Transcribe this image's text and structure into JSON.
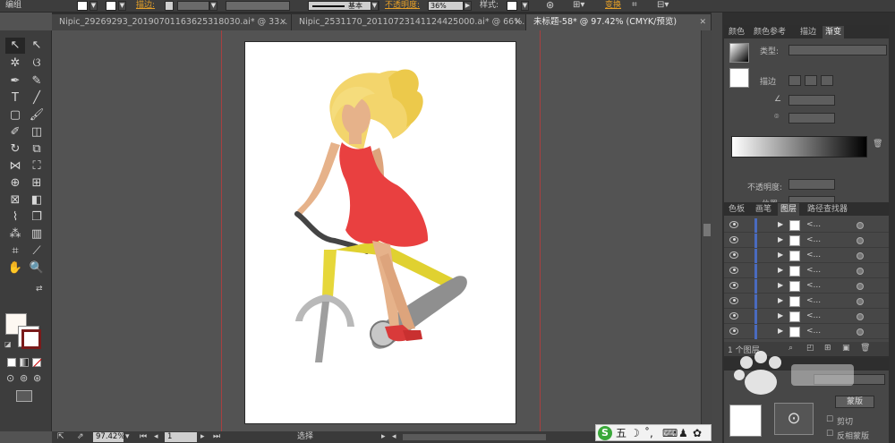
{
  "control_bar": {
    "group_label": "编组",
    "stroke_label": "描边:",
    "stroke_style": "基本",
    "opacity_label": "不透明度:",
    "opacity_value": "36%",
    "style_label": "样式:",
    "transform_label": "变换"
  },
  "tabs": [
    {
      "label": "Nipic_29269293_20190701163625318030.ai* @ 33...",
      "active": false
    },
    {
      "label": "Nipic_2531170_20110723141124425000.ai* @ 66%...",
      "active": false
    },
    {
      "label": "未标题-58* @ 97.42% (CMYK/预览)",
      "active": true
    }
  ],
  "status": {
    "zoom": "97.42%",
    "page": "1",
    "tool_name": "选择"
  },
  "panels": {
    "gradient": {
      "tabs": [
        "颜色",
        "颜色参考",
        "描边",
        "渐变"
      ],
      "type_label": "类型:",
      "stroke_label": "描边",
      "opacity_label": "不透明度:",
      "location_label": "位置:"
    },
    "layers": {
      "tabs": [
        "色板",
        "画笔",
        "图层",
        "路径查找器"
      ],
      "layer_count": "1 个图层",
      "rows": [
        "<...",
        "<...",
        "<...",
        "<...",
        "<...",
        "<...",
        "<...",
        "<..."
      ]
    },
    "transparency": {
      "clip_label": "剪切",
      "invert_mask_label": "反相蒙版",
      "mask_button": "蒙版"
    }
  },
  "ime": {
    "logo": "S",
    "mode": "五"
  },
  "colors": {
    "dress": "#e94040",
    "skin": "#e6b28a",
    "hair": "#f3d56c",
    "bike_frame": "#e0d130",
    "fork": "#b9b9b9",
    "chain_guard": "#8f8f8f"
  }
}
